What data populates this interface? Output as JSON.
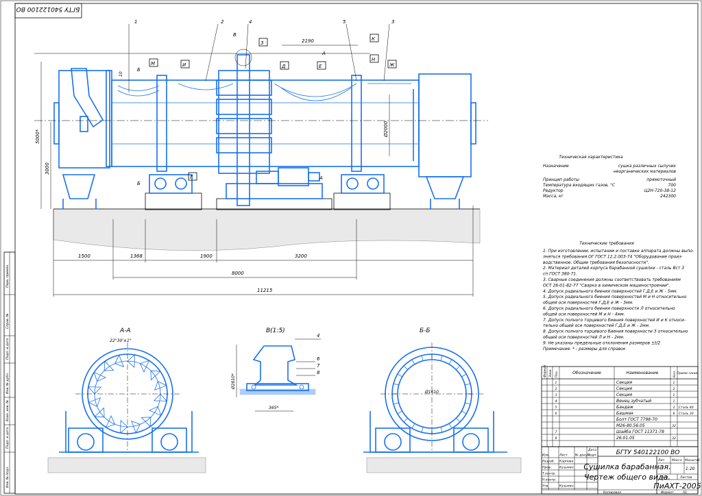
{
  "stamp_top": "БГТУ 540122100 ВО",
  "sections": {
    "aa": "А-А",
    "bb": "Б-Б",
    "detail": "В(1:5)"
  },
  "view_marks": [
    "Б",
    "М",
    "И",
    "В",
    "З",
    "Д",
    "Е",
    "А",
    "Н",
    "К",
    "Ж",
    "Б",
    "Г",
    "А"
  ],
  "callouts": [
    "1",
    "2",
    "4",
    "5",
    "3"
  ],
  "detail_callouts": [
    "4",
    "6",
    "7",
    "8"
  ],
  "dims": {
    "d_2190": "2190",
    "d_5000": "5000*",
    "d_3000": "3000",
    "d_2000": "Ø2000",
    "d_1500": "1500",
    "d_1368": "1368",
    "d_1900": "1900",
    "d_3200": "3200",
    "d_8000": "8000",
    "d_11215": "11215",
    "d_10": "10",
    "angle": "22°30'±1°",
    "d_2810": "Ø2810*",
    "d_365": "365*",
    "d_1610": "Ø1610"
  },
  "tech_char": {
    "title": "Техническая характеристика",
    "rows": [
      {
        "name": "Назначение",
        "value": "сушка различных сыпучих неорганических материалов"
      },
      {
        "name": "Принцип работы",
        "value": "прямоточный"
      },
      {
        "name": "Температура входящих газов, °С",
        "value": "700"
      },
      {
        "name": "Редуктор",
        "value": "Ц2Н-720-38-12"
      },
      {
        "name": "Масса, кг",
        "value": "242300"
      }
    ]
  },
  "tech_req": {
    "title": "Технические требования",
    "lines": [
      "1. При изготовлении, испытании и поставке аппарата должны выпо-",
      "   лняться требования ОГ ГОСТ 12.2.003-74 \"Оборудование произ-",
      "   водственное. Общие требования безопасности\".",
      "2. Материал деталей корпуса барабанной сушилки - сталь Вст 3",
      "   сп ГОСТ 380-71.",
      "3. Сварные соединения должны соответствовать требованиям",
      "   ОСТ 26-01-82-77 \"Сварка в химическом машиностроении\".",
      "4. Допуск радиального биения поверхностей Г,Д,Е и Ж - 5мм.",
      "5. Допуск радиального биения поверхностей М и Н относительно",
      "   общей оси поверхностей Г,Д,Е и Ж - 3мм.",
      "6. Допуск радиального биения поверхности Л относительно",
      "   общей оси поверхностей М и Н - 4мм.",
      "7. Допуск полного торцевого биения поверхностей И и К относи-",
      "   тельно общей оси поверхностей Г,Д,Е и Ж - 2мм.",
      "8. Допуск полного торцевого биения поверхности З относительно",
      "   общей оси поверхностей Л и Н - 2мм.",
      "9. Не указаны предельные отклонения размеров ±t/2",
      "   Примечание: * - размеры для справок"
    ]
  },
  "spec": {
    "headers": {
      "format": "Формат",
      "zone": "Зона",
      "pos": "Поз.",
      "designation": "Обозначение",
      "name": "Наименование",
      "qty": "Кол.",
      "note": "Приме-чание"
    },
    "rows": [
      {
        "pos": "1",
        "name": "Секция",
        "qty": "1",
        "note": ""
      },
      {
        "pos": "2",
        "name": "Секция",
        "qty": "2",
        "note": ""
      },
      {
        "pos": "3",
        "name": "Секция",
        "qty": "1",
        "note": ""
      },
      {
        "pos": "4",
        "name": "Венец зубчатый",
        "qty": "1",
        "note": ""
      },
      {
        "pos": "5",
        "name": "Бандаж",
        "qty": "2",
        "note": "Сталь 40"
      },
      {
        "pos": "6",
        "name": "Башмак",
        "qty": "8",
        "note": "Сталь 30"
      },
      {
        "pos": "",
        "name": "Болт ГОСТ 7798-70",
        "qty": "",
        "note": ""
      },
      {
        "pos": "",
        "name": "М26-80.56.05",
        "qty": "32",
        "note": ""
      },
      {
        "pos": "7",
        "name": "Шайба ГОСТ 11371-78",
        "qty": "",
        "note": ""
      },
      {
        "pos": "8",
        "name": "26.01.05",
        "qty": "32",
        "note": ""
      },
      {
        "pos": "",
        "name": "",
        "qty": "",
        "note": ""
      }
    ]
  },
  "title_block": {
    "code": "БГТУ 540122100 ВО",
    "name1": "Сушилка барабанная.",
    "name2": "Чертеж общего вида.",
    "lit": "Лит.",
    "mass_label": "Масса",
    "scale_label": "Масштаб",
    "scale": "1:20",
    "sheet": "Лист",
    "sheets": "Листов",
    "org": "ПиАХТ-2005",
    "rows": [
      {
        "role": "Изм.",
        "name": "Лист",
        "sign": "№ докум.",
        "date": "Подп."
      },
      {
        "role": "Разраб.",
        "name": "Карпова",
        "sign": "",
        "date": ""
      },
      {
        "role": "Пров.",
        "name": "Кузьмин",
        "sign": "",
        "date": ""
      },
      {
        "role": "Т.контр.",
        "name": "",
        "sign": "",
        "date": ""
      },
      {
        "role": "Н.контр.",
        "name": "",
        "sign": "",
        "date": ""
      },
      {
        "role": "Утв.",
        "name": "Кузьмин",
        "sign": "",
        "date": ""
      }
    ],
    "date_label": "Дата",
    "copied": "Копировал",
    "format": "Формат",
    "format_val": "А1"
  },
  "side_strip": [
    "Перв. примен.",
    "Справ. №",
    "Подп. и дата",
    "Инв. № дубл.",
    "Взам. инв. №",
    "Подп. и дата",
    "Инв. № подл."
  ]
}
